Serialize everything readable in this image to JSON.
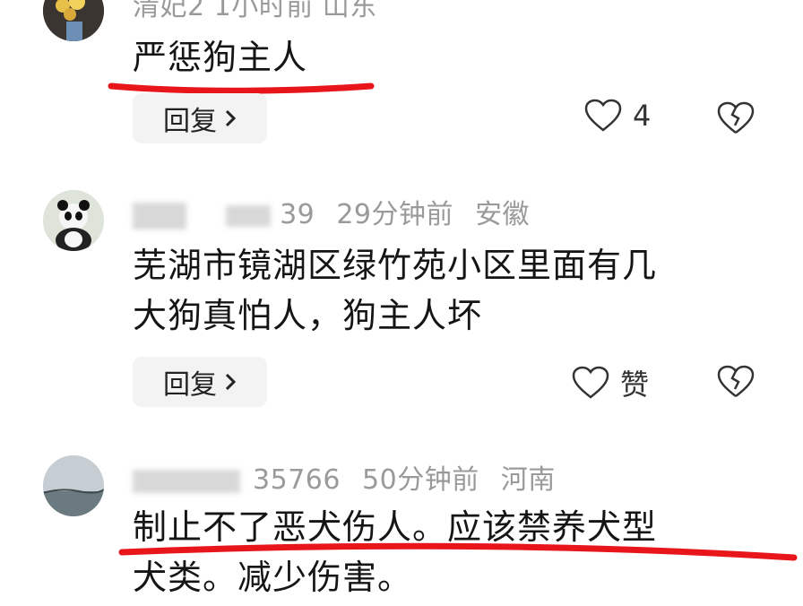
{
  "comments": [
    {
      "meta_visible": "清妃2 1小时前 山东",
      "text": "严惩狗主人",
      "reply_label": "回复",
      "likes": "4"
    },
    {
      "meta_suffix": "39",
      "time": "29分钟前",
      "location": "安徽",
      "text_line1": "芜湖市镜湖区绿竹苑小区里面有几",
      "text_line2": "大狗真怕人，狗主人坏",
      "reply_label": "回复",
      "likes": "赞"
    },
    {
      "meta_suffix": "35766",
      "time": "50分钟前",
      "location": "河南",
      "text_line1": "制止不了恶犬伤人。应该禁养犬型",
      "text_line2": "犬类。减少伤害。"
    }
  ],
  "colors": {
    "annotation_red": "#e8151b",
    "meta_gray": "#9a9a9a",
    "button_bg": "#f3f3f3"
  }
}
